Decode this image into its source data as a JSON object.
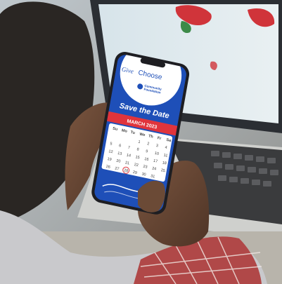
{
  "photo": {
    "subject": "person holding smartphone in front of laptop",
    "colors": {
      "brand_blue": "#1e4fb8",
      "accent_red": "#e0343c",
      "laptop_screen": "#dfe9ee",
      "hair": "#2a2623",
      "skin": "#6b4a36",
      "shirt_plaid": "#b04848"
    }
  },
  "phone_app": {
    "brand_left": "Give",
    "brand_right": "Choose",
    "partner_line1": "Community",
    "partner_line2": "Foundation",
    "headline": "Save the Date",
    "month_banner": "MARCH 2023",
    "weekday_headers": [
      "Su",
      "Mo",
      "Tu",
      "We",
      "Th",
      "Fr",
      "Sa"
    ],
    "calendar_days": [
      [
        "",
        "",
        "",
        "1",
        "2",
        "3",
        "4"
      ],
      [
        "5",
        "6",
        "7",
        "8",
        "9",
        "10",
        "11"
      ],
      [
        "12",
        "13",
        "14",
        "15",
        "16",
        "17",
        "18"
      ],
      [
        "19",
        "20",
        "21",
        "22",
        "23",
        "24",
        "25"
      ],
      [
        "26",
        "27",
        "28",
        "29",
        "30",
        "31",
        ""
      ]
    ],
    "highlighted_day": "28"
  }
}
